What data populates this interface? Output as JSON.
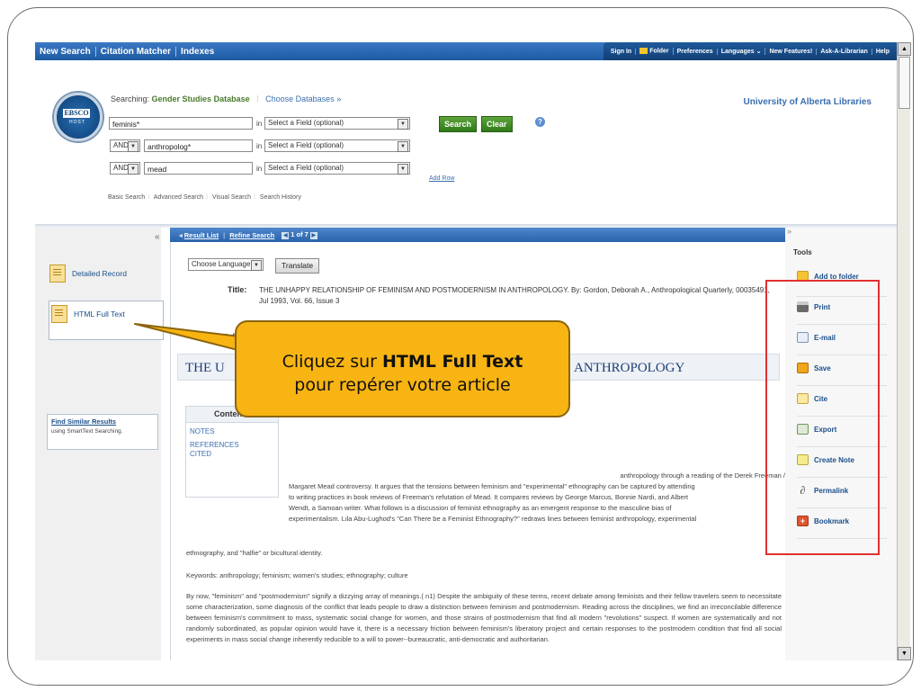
{
  "topnav": {
    "items": [
      "New Search",
      "Citation Matcher",
      "Indexes"
    ],
    "right_items": [
      "Sign In",
      "Folder",
      "Preferences",
      "Languages ⌄",
      "New Features!",
      "Ask-A-Librarian",
      "Help"
    ]
  },
  "logo": {
    "line1": "EBSCO",
    "line2": "HOST"
  },
  "searching": {
    "label": "Searching:",
    "database": "Gender Studies Database",
    "choose": "Choose Databases »"
  },
  "university": "University of Alberta Libraries",
  "search": {
    "rows": [
      {
        "bool": "",
        "term": "feminis*",
        "in": "in",
        "field": "Select a Field (optional)"
      },
      {
        "bool": "AND",
        "term": "anthropolog*",
        "in": "in",
        "field": "Select a Field (optional)"
      },
      {
        "bool": "AND",
        "term": "mead",
        "in": "in",
        "field": "Select a Field (optional)"
      }
    ],
    "search_btn": "Search",
    "clear_btn": "Clear",
    "add_row": "Add Row",
    "links": [
      "Basic Search",
      "Advanced Search",
      "Visual Search",
      "Search History"
    ]
  },
  "left": {
    "collapse": "«",
    "detailed_record": "Detailed Record",
    "html_full_text": "HTML Full Text",
    "similar_title": "Find Similar Results",
    "similar_sub": "using SmartText Searching."
  },
  "record": {
    "result_list": "Result List",
    "refine": "Refine Search",
    "paging": "1 of 7",
    "prev": "◀",
    "next": "▶",
    "choose_language": "Choose Language",
    "translate": "Translate",
    "title_label": "Title:",
    "title_text": "THE UNHAPPY RELATIONSHIP OF FEMINISM AND POSTMODERNISM IN ANTHROPOLOGY. By: Gordon, Deborah A., Anthropological Quarterly, 00035491, Jul 1993, Vol. 66, Issue 3",
    "database_label": "Databa",
    "big_title_left": "THE U",
    "big_title_right": "ANTHROPOLOGY",
    "contents_header": "Conten",
    "contents_items": [
      "NOTES",
      "REFERENCES CITED"
    ],
    "abstract_lines": [
      "anthropology through a reading of the Derek Freeman /",
      "Margaret Mead controversy. It argues that the tensions between feminism and \"experimental\" ethnography can be captured by attending",
      "to writing practices in book reviews of Freeman's refutation of Mead. It compares reviews by George Marcus, Bonnie Nardi, and Albert",
      "Wendt, a Samoan writer. What follows is a discussion of feminist ethnography as an emergent response to the masculine bias of",
      "experimentalism. Lila Abu-Lughod's \"Can There be a Feminist Ethnography?\" redraws lines between feminist anthropology, experimental"
    ],
    "abstract_tail": "ethnography, and \"halfie\" or bicultural identity.",
    "keywords": "Keywords: anthropology; feminism; women's studies; ethnography; culture",
    "body": "By now, \"feminism\" and \"postmodernism\" signify a dizzying array of meanings.( n1) Despite the ambiguity of these terms, recent debate among feminists and their fellow travelers seem to necessitate some characterization, some diagnosis of the conflict that leads people to draw a distinction between feminism and postmodernism. Reading across the disciplines, we find an irreconcilable difference between feminism's commitment to mass, systematic social change for women, and those strains of postmodernism that find all modern \"revolutions\" suspect. If women are systematically and not randomly subordinated, as popular opinion would have it, there is a necessary friction between feminism's liberatory project and certain responses to the postmodern condition that find all social experiments in mass social change inherently reducible to a will to power--bureaucratic, anti-democratic and authoritarian."
  },
  "tools": {
    "collapse": "»",
    "header": "Tools",
    "items": [
      "Add to folder",
      "Print",
      "E-mail",
      "Save",
      "Cite",
      "Export",
      "Create Note",
      "Permalink",
      "Bookmark"
    ]
  },
  "callout": {
    "prefix": "Cliquez sur ",
    "bold": "HTML Full Text",
    "line2": "pour repérer votre article"
  },
  "colors": {
    "accent_blue": "#2963aa",
    "callout": "#f8b412",
    "highlight": "#e23030",
    "green_button": "#3a8a20"
  }
}
